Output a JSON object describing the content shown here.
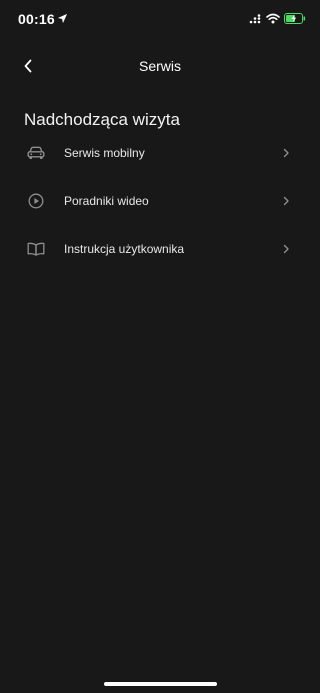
{
  "status_bar": {
    "time": "00:16",
    "icons": [
      "location-arrow-icon",
      "signal-icon",
      "wifi-icon",
      "battery-charging-icon"
    ],
    "battery_color": "#4cd964"
  },
  "nav": {
    "back_icon": "chevron-left-icon",
    "title": "Serwis"
  },
  "section": {
    "title": "Nadchodząca wizyta"
  },
  "menu": {
    "items": [
      {
        "label": "Serwis mobilny",
        "icon": "car-icon"
      },
      {
        "label": "Poradniki wideo",
        "icon": "play-circle-icon"
      },
      {
        "label": "Instrukcja użytkownika",
        "icon": "book-icon"
      }
    ],
    "chevron_icon": "chevron-right-icon"
  },
  "colors": {
    "background": "#181818",
    "text": "#ffffff",
    "icon": "#8e8e8e"
  }
}
